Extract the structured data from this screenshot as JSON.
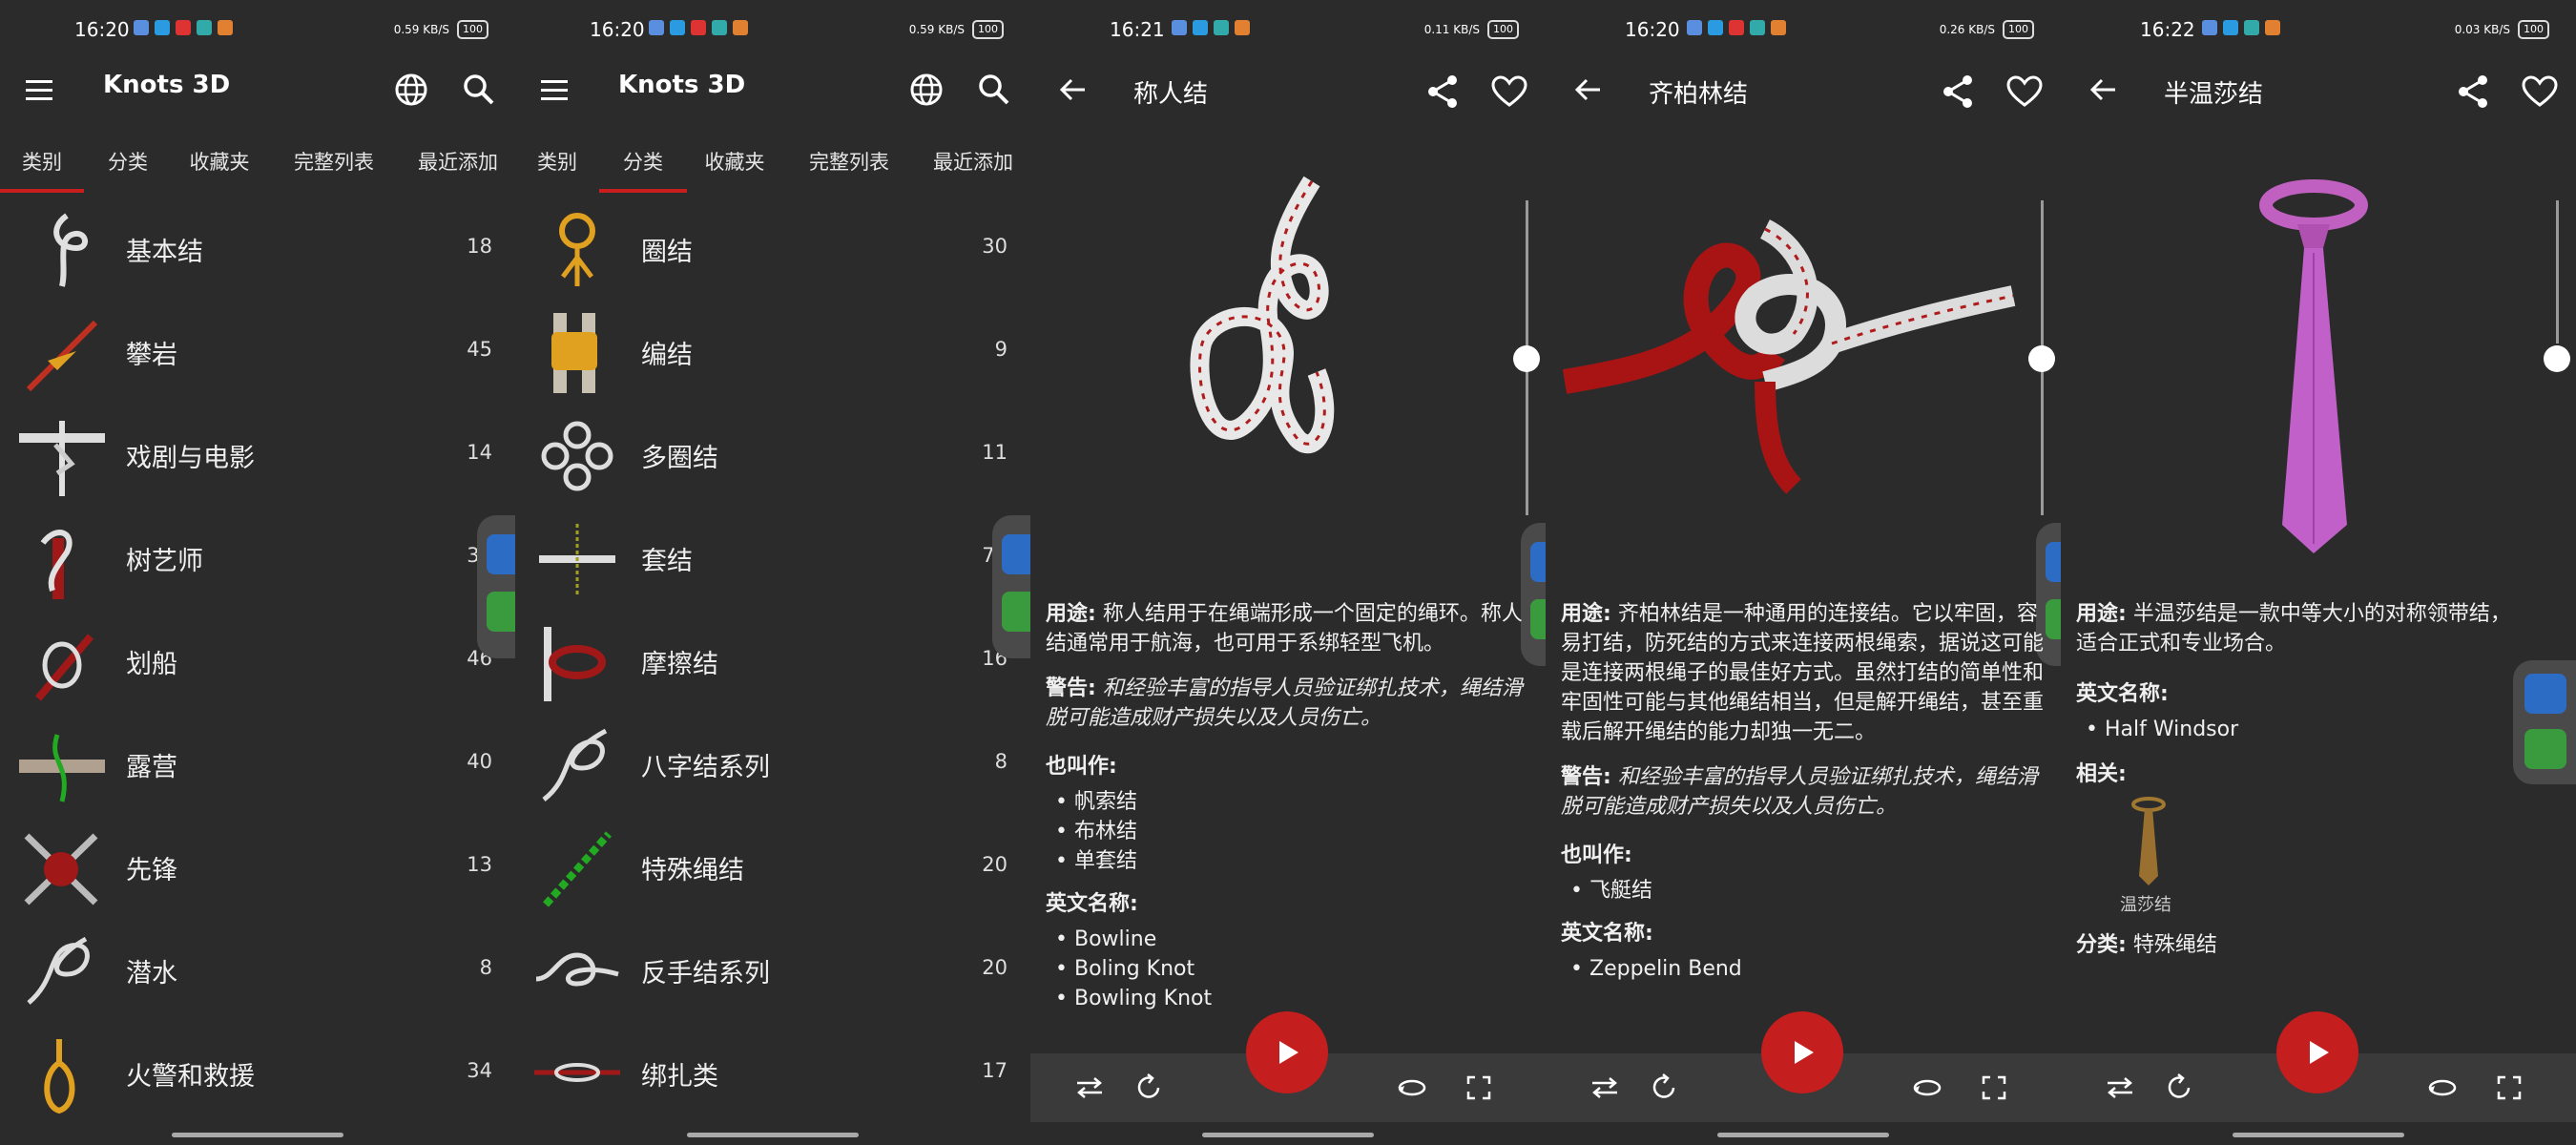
{
  "screens": [
    {
      "status_time": "16:20",
      "app_title": "Knots 3D",
      "tabs": [
        "类别",
        "分类",
        "收藏夹",
        "完整列表",
        "最近添加"
      ],
      "active_tab": 0,
      "rows": [
        {
          "label": "基本结",
          "count": "18"
        },
        {
          "label": "攀岩",
          "count": "45"
        },
        {
          "label": "戏剧与电影",
          "count": "14"
        },
        {
          "label": "树艺师",
          "count": "36"
        },
        {
          "label": "划船",
          "count": "46"
        },
        {
          "label": "露营",
          "count": "40"
        },
        {
          "label": "先锋",
          "count": "13"
        },
        {
          "label": "潜水",
          "count": "8"
        },
        {
          "label": "火警和救援",
          "count": "34"
        }
      ]
    },
    {
      "status_time": "16:20",
      "app_title": "Knots 3D",
      "tabs": [
        "类别",
        "分类",
        "收藏夹",
        "完整列表",
        "最近添加"
      ],
      "active_tab": 1,
      "rows": [
        {
          "label": "圈结",
          "count": "30"
        },
        {
          "label": "编结",
          "count": "9"
        },
        {
          "label": "多圈结",
          "count": "11"
        },
        {
          "label": "套结",
          "count": "79"
        },
        {
          "label": "摩擦结",
          "count": "16"
        },
        {
          "label": "八字结系列",
          "count": "8"
        },
        {
          "label": "特殊绳结",
          "count": "20"
        },
        {
          "label": "反手结系列",
          "count": "20"
        },
        {
          "label": "绑扎类",
          "count": "17"
        }
      ]
    },
    {
      "status_time": "16:21",
      "title": "称人结",
      "use_label": "用途:",
      "use_text": "称人结用于在绳端形成一个固定的绳环。称人结通常用于航海，也可用于系绑轻型飞机。",
      "warn_label": "警告:",
      "warn_text": "和经验丰富的指导人员验证绑扎技术，绳结滑脱可能造成财产损失以及人员伤亡。",
      "aka_label": "也叫作:",
      "aka": [
        "帆索结",
        "布林结",
        "单套结"
      ],
      "en_label": "英文名称:",
      "en": [
        "Bowline",
        "Boling Knot",
        "Bowling Knot"
      ]
    },
    {
      "status_time": "16:20",
      "title": "齐柏林结",
      "use_label": "用途:",
      "use_text": "齐柏林结是一种通用的连接结。它以牢固，容易打结，防死结的方式来连接两根绳索，据说这可能是连接两根绳子的最佳好方式。虽然打结的简单性和牢固性可能与其他绳结相当，但是解开绳结，甚至重载后解开绳结的能力却独一无二。",
      "warn_label": "警告:",
      "warn_text": "和经验丰富的指导人员验证绑扎技术，绳结滑脱可能造成财产损失以及人员伤亡。",
      "aka_label": "也叫作:",
      "aka": [
        "飞艇结"
      ],
      "en_label": "英文名称:",
      "en": [
        "Zeppelin Bend"
      ]
    },
    {
      "status_time": "16:22",
      "title": "半温莎结",
      "use_label": "用途:",
      "use_text": "半温莎结是一款中等大小的对称领带结，适合正式和专业场合。",
      "en_label": "英文名称:",
      "en": [
        "Half Windsor"
      ],
      "related_label": "相关:",
      "related_item": "温莎结",
      "category_label": "分类:",
      "category_value": "特殊绳结"
    }
  ],
  "status_speeds": [
    "0.59 KB/S",
    "0.59 KB/S",
    "0.11 KB/S",
    "0.26 KB/S",
    "0.03 KB/S"
  ],
  "battery": "100",
  "icons": [
    "menu-icon",
    "globe-icon",
    "search-icon",
    "back-icon",
    "share-icon",
    "heart-icon",
    "play-icon",
    "swap-icon",
    "loop-icon",
    "rotate-icon",
    "fullscreen-icon"
  ],
  "colors": {
    "accent": "#c81e1e",
    "background": "#2b2b2b",
    "bar": "#3a3a3a"
  }
}
